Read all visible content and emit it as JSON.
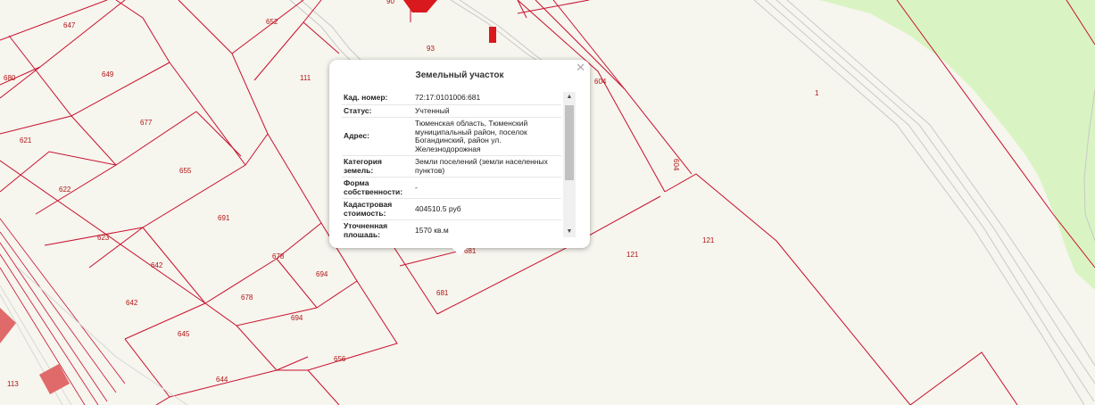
{
  "map": {
    "plot_numbers": [
      "90",
      "652",
      "647",
      "649",
      "680",
      "93",
      "111",
      "604",
      "1",
      "621",
      "677",
      "655",
      "622",
      "691",
      "623",
      "642",
      "678",
      "694",
      "642",
      "678",
      "694",
      "645",
      "656",
      "113",
      "644",
      "681",
      "681",
      "121",
      "121",
      "604"
    ],
    "colors": {
      "background": "#f6f5ee",
      "parcel_border": "#c8102e",
      "label": "#b01515",
      "green_area": "#d9f4c2",
      "road": "#c8c8c8",
      "building": "#e06a6a"
    }
  },
  "popup": {
    "title": "Земельный участок",
    "close_icon": "close-icon",
    "rows": [
      {
        "key": "Кад. номер:",
        "value": "72:17:0101006:681"
      },
      {
        "key": "Статус:",
        "value": "Учтенный"
      },
      {
        "key": "Адрес:",
        "value": "Тюменская область, Тюменский муниципальный район, поселок Богандинский, район ул. Железнодорожная"
      },
      {
        "key": "Категория земель:",
        "value": "Земли поселений (земли населенных пунктов)"
      },
      {
        "key": "Форма собственности:",
        "value": "-"
      },
      {
        "key": "Кадастровая стоимость:",
        "value": "404510.5 руб"
      },
      {
        "key": "Уточненная площадь:",
        "value": "1570 кв.м"
      }
    ],
    "scroll_up_icon": "triangle-up-icon",
    "scroll_down_icon": "triangle-down-icon"
  }
}
